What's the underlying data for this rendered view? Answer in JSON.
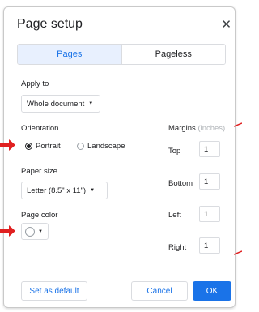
{
  "dialog": {
    "title": "Page setup",
    "close_icon": "close-icon"
  },
  "tabs": [
    {
      "label": "Pages",
      "active": true
    },
    {
      "label": "Pageless",
      "active": false
    }
  ],
  "apply_to": {
    "label": "Apply to",
    "value": "Whole document"
  },
  "orientation": {
    "label": "Orientation",
    "options": [
      {
        "label": "Portrait",
        "checked": true
      },
      {
        "label": "Landscape",
        "checked": false
      }
    ]
  },
  "paper_size": {
    "label": "Paper size",
    "value": "Letter (8.5\" x 11\")"
  },
  "page_color": {
    "label": "Page color",
    "value": "#ffffff"
  },
  "margins": {
    "label": "Margins",
    "unit": "(inches)",
    "fields": [
      {
        "label": "Top",
        "value": "1"
      },
      {
        "label": "Bottom",
        "value": "1"
      },
      {
        "label": "Left",
        "value": "1"
      },
      {
        "label": "Right",
        "value": "1"
      }
    ]
  },
  "footer": {
    "set_default_label": "Set as default",
    "cancel_label": "Cancel",
    "ok_label": "OK"
  },
  "colors": {
    "accent": "#1a73e8",
    "annotation": "#e02020"
  }
}
